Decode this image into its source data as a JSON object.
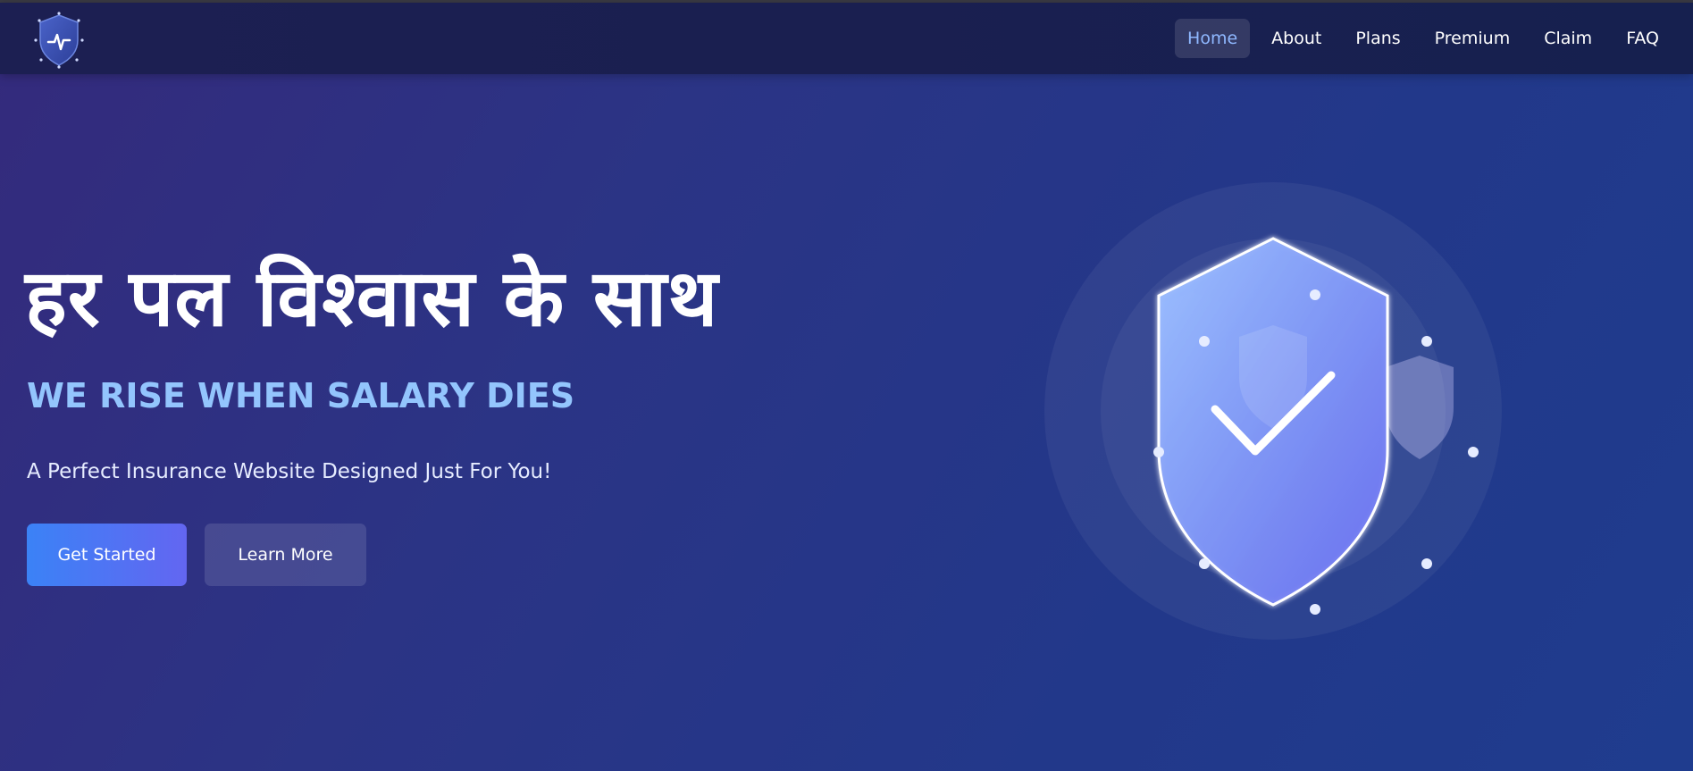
{
  "navbar": {
    "logo_icon": "shield-pulse-logo-icon",
    "links": [
      {
        "label": "Home",
        "active": true
      },
      {
        "label": "About",
        "active": false
      },
      {
        "label": "Plans",
        "active": false
      },
      {
        "label": "Premium",
        "active": false
      },
      {
        "label": "Claim",
        "active": false
      },
      {
        "label": "FAQ",
        "active": false
      }
    ]
  },
  "hero": {
    "title": "हर पल विश्वास के साथ",
    "slogan": "WE RISE WHEN SALARY DIES",
    "subtitle": "A Perfect Insurance Website Designed Just For You!",
    "primary_button": "Get Started",
    "secondary_button": "Learn More",
    "illustration_icon": "shield-check-icon"
  },
  "colors": {
    "accent_light_blue": "#93c5fd",
    "button_gradient_start": "#3b82f6",
    "button_gradient_end": "#6366f1",
    "nav_background": "#1a1f50"
  }
}
